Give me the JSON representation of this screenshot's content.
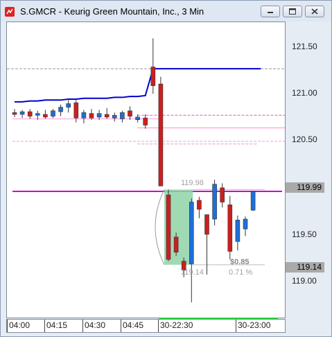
{
  "window": {
    "title": "S.GMCR - Keurig Green Mountain, Inc., 3 Min",
    "icons": [
      "app-icon",
      "minimize-icon",
      "restore-icon",
      "close-icon"
    ]
  },
  "y_axis": {
    "labels": [
      "121.50",
      "121.00",
      "120.50",
      "119.50",
      "119.00"
    ],
    "tags": {
      "last_price": "119.99",
      "measure_low": "119.14"
    }
  },
  "x_axis": {
    "labels": [
      "04:00",
      "04:15",
      "04:30",
      "04:45",
      "30-22:30",
      "30-23:00"
    ]
  },
  "annotations": {
    "measure_high": "119.98",
    "measure_low": "119.14",
    "measure_change": "$0.85",
    "measure_pct": "0.71 %"
  },
  "chart_data": {
    "type": "candlestick",
    "ylim": [
      118.55,
      121.85
    ],
    "timeframe": "3 Min",
    "candles": [
      {
        "o": 120.84,
        "h": 120.88,
        "l": 120.79,
        "c": 120.82
      },
      {
        "o": 120.82,
        "h": 120.87,
        "l": 120.78,
        "c": 120.85
      },
      {
        "o": 120.85,
        "h": 120.88,
        "l": 120.77,
        "c": 120.8
      },
      {
        "o": 120.81,
        "h": 120.86,
        "l": 120.76,
        "c": 120.83
      },
      {
        "o": 120.82,
        "h": 120.87,
        "l": 120.77,
        "c": 120.79
      },
      {
        "o": 120.8,
        "h": 120.88,
        "l": 120.78,
        "c": 120.86
      },
      {
        "o": 120.85,
        "h": 120.93,
        "l": 120.8,
        "c": 120.9
      },
      {
        "o": 120.9,
        "h": 120.98,
        "l": 120.84,
        "c": 120.94
      },
      {
        "o": 120.95,
        "h": 120.98,
        "l": 120.73,
        "c": 120.78
      },
      {
        "o": 120.78,
        "h": 120.87,
        "l": 120.72,
        "c": 120.84
      },
      {
        "o": 120.83,
        "h": 120.88,
        "l": 120.76,
        "c": 120.78
      },
      {
        "o": 120.79,
        "h": 120.87,
        "l": 120.76,
        "c": 120.83
      },
      {
        "o": 120.82,
        "h": 120.89,
        "l": 120.77,
        "c": 120.79
      },
      {
        "o": 120.78,
        "h": 120.84,
        "l": 120.74,
        "c": 120.81
      },
      {
        "o": 120.77,
        "h": 120.86,
        "l": 120.73,
        "c": 120.84
      },
      {
        "o": 120.86,
        "h": 120.91,
        "l": 120.76,
        "c": 120.8
      },
      {
        "o": 120.76,
        "h": 120.82,
        "l": 120.73,
        "c": 120.79
      },
      {
        "o": 120.78,
        "h": 120.82,
        "l": 120.66,
        "c": 120.7
      },
      {
        "o": 121.35,
        "h": 121.67,
        "l": 121.05,
        "c": 121.14
      },
      {
        "o": 121.16,
        "h": 121.24,
        "l": 120.02,
        "c": 120.02
      },
      {
        "o": 119.92,
        "h": 119.98,
        "l": 119.18,
        "c": 119.2
      },
      {
        "o": 119.45,
        "h": 119.5,
        "l": 119.24,
        "c": 119.28
      },
      {
        "o": 119.18,
        "h": 119.22,
        "l": 119.0,
        "c": 119.08
      },
      {
        "o": 119.15,
        "h": 119.88,
        "l": 118.72,
        "c": 119.84
      },
      {
        "o": 119.86,
        "h": 119.9,
        "l": 119.66,
        "c": 119.76
      },
      {
        "o": 119.7,
        "h": 119.7,
        "l": 119.03,
        "c": 119.48
      },
      {
        "o": 119.65,
        "h": 120.09,
        "l": 119.58,
        "c": 120.04
      },
      {
        "o": 120.0,
        "h": 120.05,
        "l": 119.78,
        "c": 119.84
      },
      {
        "o": 119.81,
        "h": 119.91,
        "l": 119.2,
        "c": 119.29
      },
      {
        "o": 119.4,
        "h": 119.69,
        "l": 119.3,
        "c": 119.64
      },
      {
        "o": 119.54,
        "h": 119.68,
        "l": 119.46,
        "c": 119.65
      },
      {
        "o": 119.75,
        "h": 119.96,
        "l": 119.74,
        "c": 119.96
      }
    ],
    "indicator_line": {
      "name": "blue line",
      "color": "#0000cc",
      "values": [
        120.96,
        120.96,
        120.97,
        120.97,
        120.98,
        120.98,
        120.98,
        120.99,
        120.99,
        121.0,
        121.0,
        121.0,
        121.0,
        121.01,
        121.01,
        121.02,
        121.02,
        121.03,
        121.33,
        121.33,
        121.33,
        121.33,
        121.33,
        121.33,
        121.33,
        121.33,
        121.33,
        121.33,
        121.33,
        121.33,
        121.33,
        121.33,
        121.33
      ]
    },
    "reference_lines": [
      {
        "value": 121.33,
        "color": "#999999",
        "style": "dashed",
        "from": 0,
        "to": 1
      },
      {
        "value": 120.81,
        "color": "#e055c0",
        "style": "dashed",
        "from": 0.47,
        "to": 1
      },
      {
        "value": 120.77,
        "color": "#ff99dd",
        "style": "solid",
        "from": 0.02,
        "to": 0.55
      },
      {
        "value": 120.67,
        "color": "#ff88cc",
        "style": "solid",
        "from": 0.47,
        "to": 1
      },
      {
        "value": 120.52,
        "color": "#f0a0d8",
        "style": "dashed",
        "from": 0.02,
        "to": 1
      },
      {
        "value": 120.49,
        "color": "#e0a0c8",
        "style": "dashed",
        "from": 0.47,
        "to": 0.9
      },
      {
        "value": 119.96,
        "color": "#cc00cc",
        "style": "solid",
        "from": 0.02,
        "to": 0.99
      }
    ],
    "measure_box": {
      "high": 119.98,
      "low": 119.14,
      "change": 0.85,
      "pct": 0.71
    }
  },
  "colors": {
    "up_candle": "#1e6fd9",
    "down_candle": "#cc1f1f",
    "measure_fill": "#8fd3a8",
    "last_price_line": "#cc00cc",
    "time_bar": "#2ecc40"
  }
}
